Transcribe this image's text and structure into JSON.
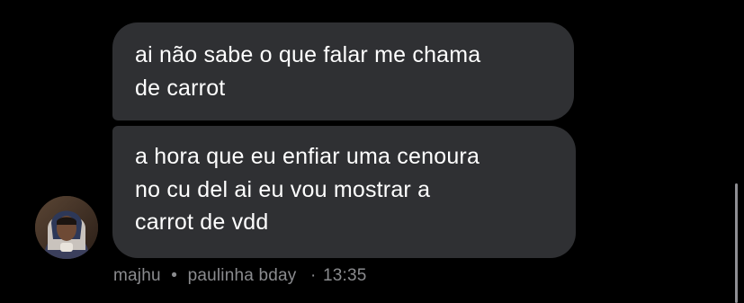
{
  "messages": [
    {
      "lines": [
        "ai não sabe o que falar me chama",
        "de carrot"
      ]
    },
    {
      "lines": [
        "a hora que eu enfiar uma cenoura",
        "no cu del ai eu vou mostrar a",
        "carrot de vdd"
      ]
    }
  ],
  "meta": {
    "sender": "majhu",
    "separator": "•",
    "group": "paulinha bday",
    "time_separator": "·",
    "time": "13:35"
  },
  "colors": {
    "background": "#000000",
    "bubble": "#2f3033",
    "text": "#ffffff",
    "meta_text": "#8a8b8e"
  },
  "icons": {
    "avatar": "sender-avatar-photo"
  }
}
